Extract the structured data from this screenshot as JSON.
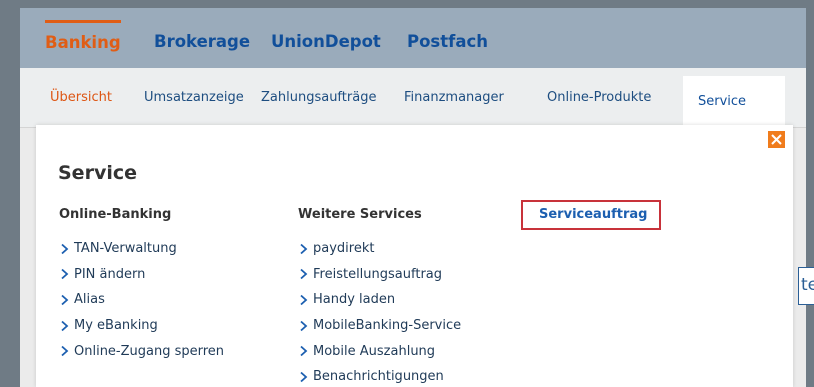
{
  "main_nav": {
    "tabs": [
      {
        "label": "Banking",
        "active": true
      },
      {
        "label": "Brokerage",
        "active": false
      },
      {
        "label": "UnionDepot",
        "active": false
      },
      {
        "label": "Postfach",
        "active": false
      }
    ]
  },
  "sub_nav": {
    "items": [
      {
        "label": "Übersicht"
      },
      {
        "label": "Umsatzanzeige"
      },
      {
        "label": "Zahlungsaufträge"
      },
      {
        "label": "Finanzmanager"
      },
      {
        "label": "Online-Produkte"
      },
      {
        "label": "Service"
      }
    ]
  },
  "popup": {
    "title": "Service",
    "close_icon": "close-icon",
    "columns": [
      {
        "heading": "Online-Banking",
        "links": [
          "TAN-Verwaltung",
          "PIN ändern",
          "Alias",
          "My eBanking",
          "Online-Zugang sperren"
        ]
      },
      {
        "heading": "Weitere Services",
        "links": [
          "paydirekt",
          "Freistellungsauftrag",
          "Handy laden",
          "MobileBanking-Service",
          "Mobile Auszahlung",
          "Benachrichtigungen"
        ]
      }
    ],
    "highlighted_link": "Serviceauftrag"
  },
  "background": {
    "partial_button_text": "ter"
  },
  "colors": {
    "accent_orange": "#e05d15",
    "nav_blue": "#114f9a",
    "highlight_red": "#c8323a",
    "header_bg": "#9aabbb"
  }
}
